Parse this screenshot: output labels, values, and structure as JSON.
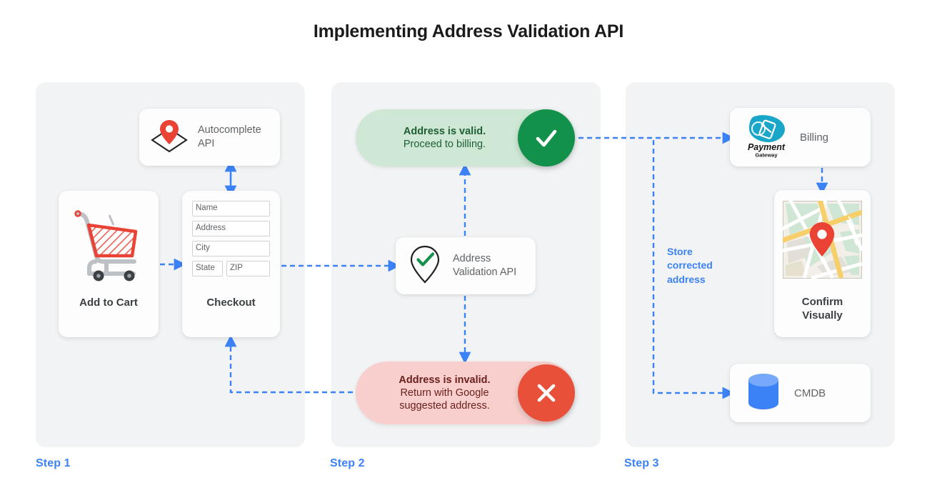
{
  "title": "Implementing Address Validation API",
  "colors": {
    "accent_blue": "#3b82f6",
    "panel_bg": "#f1f3f4",
    "valid_pill_bg": "#cfe8d5",
    "valid_badge": "#11914a",
    "invalid_pill_bg": "#f8cfcc",
    "invalid_badge": "#e8503a",
    "pin_red": "#ea4335",
    "cmdb_blue": "#3b82f6",
    "payment_teal": "#1aa6c8"
  },
  "steps": [
    {
      "label": "Step 1"
    },
    {
      "label": "Step 2"
    },
    {
      "label": "Step 3"
    }
  ],
  "step1": {
    "autocomplete_card": {
      "icon": "map-pin-diamond-icon",
      "label": "Autocomplete API"
    },
    "add_to_cart_card": {
      "icon": "shopping-cart-icon",
      "title": "Add to Cart"
    },
    "checkout_card": {
      "title": "Checkout",
      "fields": [
        {
          "name": "name-field",
          "value": "Name"
        },
        {
          "name": "address-field",
          "value": "Address"
        },
        {
          "name": "city-field",
          "value": "City"
        },
        {
          "name": "state-field",
          "value": "State"
        },
        {
          "name": "zip-field",
          "value": "ZIP"
        }
      ]
    }
  },
  "step2": {
    "valid_pill": {
      "line1": "Address is valid.",
      "line2": "Proceed to billing.",
      "badge_icon": "check-icon"
    },
    "validation_card": {
      "icon": "pin-check-icon",
      "line1": "Address",
      "line2": "Validation API"
    },
    "invalid_pill": {
      "line1": "Address is invalid.",
      "line2": "Return with Google",
      "line3": "suggested address.",
      "badge_icon": "close-icon"
    }
  },
  "step3": {
    "billing_card": {
      "icon": "payment-gateway-logo",
      "logo_name": "Payment",
      "logo_sub": "Gateway",
      "label": "Billing"
    },
    "confirm_card": {
      "icon": "map-thumbnail-icon",
      "title_line1": "Confirm",
      "title_line2": "Visually"
    },
    "cmdb_card": {
      "icon": "database-icon",
      "label": "CMDB"
    },
    "store_note": "Store corrected address"
  }
}
